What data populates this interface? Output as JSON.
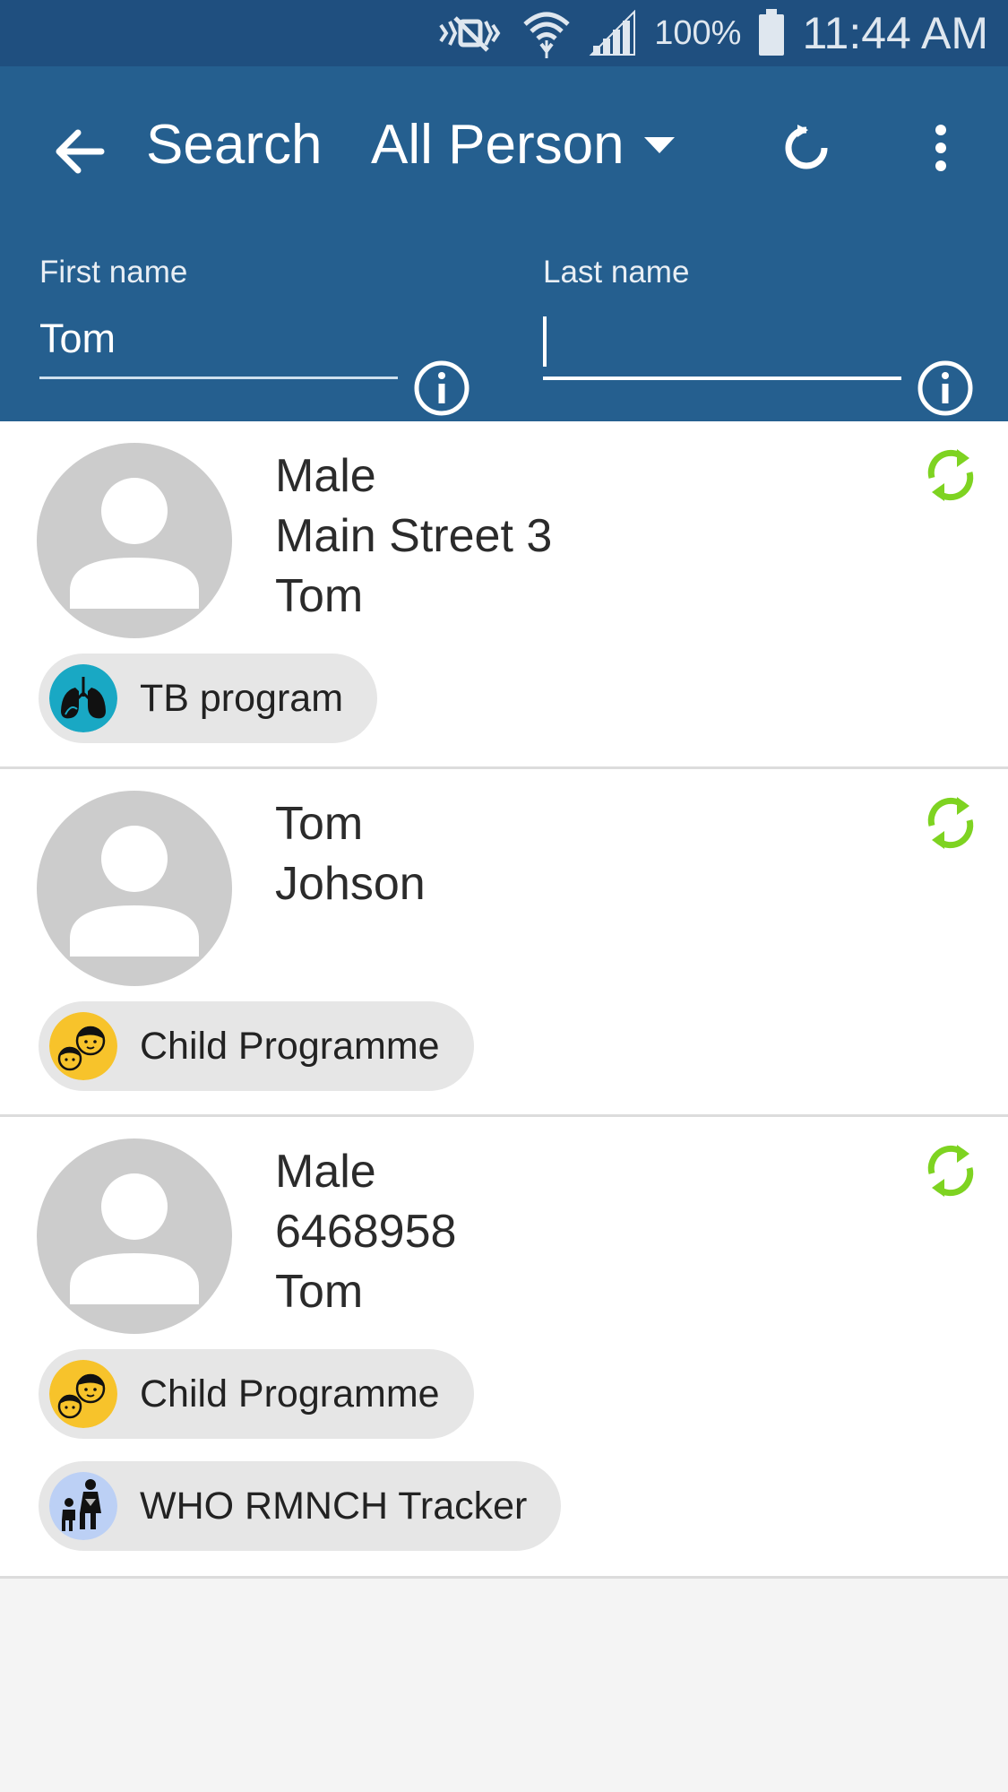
{
  "status_bar": {
    "battery": "100%",
    "time": "11:44 AM",
    "icons": [
      "mute-icon",
      "wifi-icon",
      "signal-icon",
      "battery-icon"
    ]
  },
  "toolbar": {
    "back_icon": "arrow-back-icon",
    "title": "Search",
    "program_selector": "All Person",
    "refresh_icon": "refresh-icon",
    "more_icon": "more-vertical-icon"
  },
  "search": {
    "first_name": {
      "label": "First name",
      "value": "Tom"
    },
    "last_name": {
      "label": "Last name",
      "value": ""
    }
  },
  "results": [
    {
      "lines": [
        "Male",
        "Main Street 3",
        "Tom"
      ],
      "programs": [
        {
          "label": "TB program",
          "icon": "lungs-icon",
          "color": "#19a8c4"
        }
      ]
    },
    {
      "lines": [
        "Tom",
        "Johson"
      ],
      "programs": [
        {
          "label": "Child Programme",
          "icon": "children-icon",
          "color": "#f7c32b"
        }
      ]
    },
    {
      "lines": [
        "Male",
        "6468958",
        "Tom"
      ],
      "programs": [
        {
          "label": "Child Programme",
          "icon": "children-icon",
          "color": "#f7c32b"
        },
        {
          "label": "WHO RMNCH Tracker",
          "icon": "family-icon",
          "color": "#bcd0f5"
        }
      ]
    }
  ],
  "colors": {
    "status_bar": "#1f4f7f",
    "toolbar": "#255f8f",
    "sync": "#7ed321",
    "avatar": "#cccccc",
    "chip": "#e6e6e6"
  }
}
